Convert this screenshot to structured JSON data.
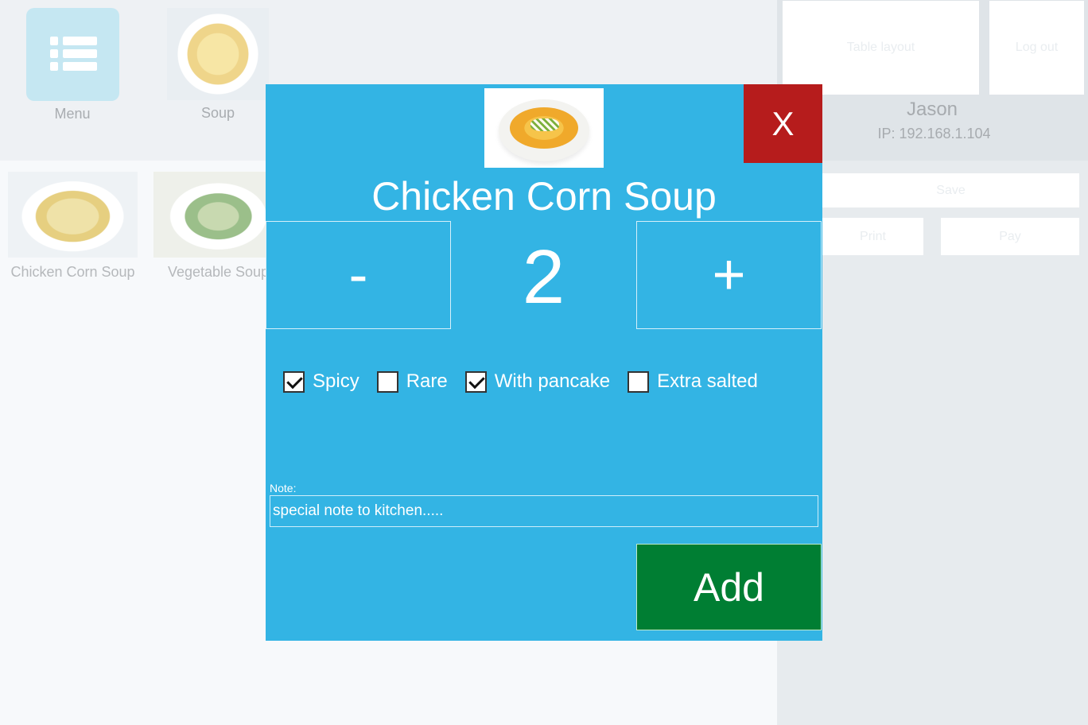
{
  "categories": [
    {
      "label": "Menu",
      "icon": "list-icon"
    },
    {
      "label": "Soup",
      "icon": "soup-image"
    }
  ],
  "items": [
    {
      "label": "Chicken Corn Soup"
    },
    {
      "label": "Vegetable Soup"
    }
  ],
  "right_panel": {
    "buttons": {
      "table_layout": "Table layout",
      "logout": "Log out",
      "save": "Save",
      "print": "Print",
      "pay": "Pay"
    },
    "user_name": "Jason",
    "ip": "IP: 192.168.1.104"
  },
  "dialog": {
    "close_label": "X",
    "title": "Chicken Corn Soup",
    "minus_label": "-",
    "plus_label": "+",
    "quantity": "2",
    "options": [
      {
        "label": "Spicy",
        "checked": true
      },
      {
        "label": "Rare",
        "checked": false
      },
      {
        "label": "With pancake",
        "checked": true
      },
      {
        "label": "Extra salted",
        "checked": false
      }
    ],
    "note_label": "Note:",
    "note_value": "special note to kitchen.....",
    "add_label": "Add"
  },
  "colors": {
    "dialog_bg": "#33b4e4",
    "close_bg": "#b61c1c",
    "add_bg": "#007e33"
  }
}
